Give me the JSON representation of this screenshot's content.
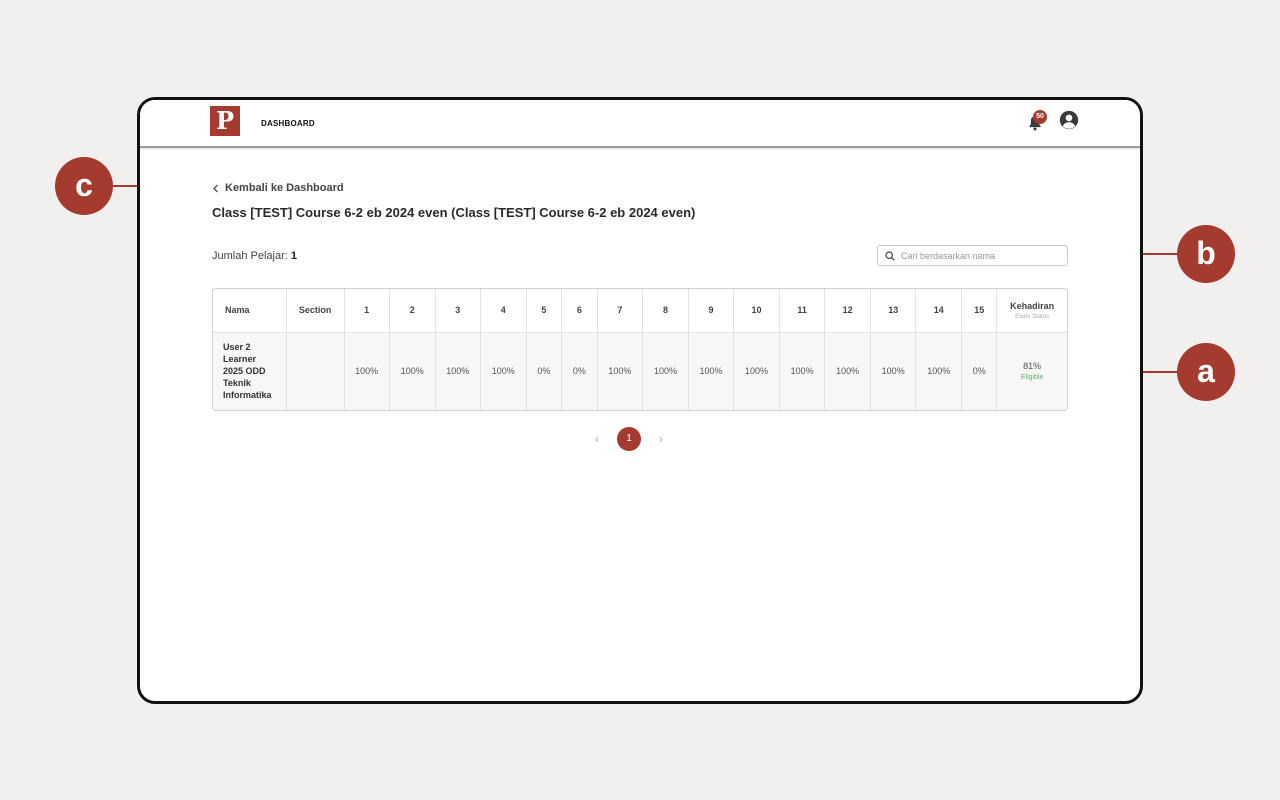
{
  "header": {
    "logo_letter": "P",
    "nav_label": "DASHBOARD",
    "notification_count": "50"
  },
  "back_link": "Kembali ke Dashboard",
  "title": "Class [TEST] Course 6-2 eb 2024 even (Class [TEST] Course 6-2 eb 2024 even)",
  "student_count": {
    "label": "Jumlah Pelajar:",
    "value": "1"
  },
  "search": {
    "placeholder": "Cari berdasarkan nama"
  },
  "table": {
    "name_header": "Nama",
    "section_header": "Section",
    "session_headers": [
      "1",
      "2",
      "3",
      "4",
      "5",
      "6",
      "7",
      "8",
      "9",
      "10",
      "11",
      "12",
      "13",
      "14",
      "15"
    ],
    "attendance_header": "Kehadiran",
    "attendance_subheader": "Exam Status",
    "rows": [
      {
        "name_lines": [
          "User 2",
          "Learner",
          "2025 ODD",
          "Teknik",
          "Informatika"
        ],
        "section": "",
        "sessions": [
          "100%",
          "100%",
          "100%",
          "100%",
          "0%",
          "0%",
          "100%",
          "100%",
          "100%",
          "100%",
          "100%",
          "100%",
          "100%",
          "100%",
          "0%"
        ],
        "attendance": "81%",
        "status": "Eligible"
      }
    ]
  },
  "pagination": {
    "current": "1",
    "prev": "‹",
    "next": "›"
  },
  "callouts": {
    "a": "a",
    "b": "b",
    "c": "c"
  },
  "colors": {
    "accent": "#a53a2f",
    "eligible": "#5bb36b"
  },
  "icons": [
    "notification-bell-icon",
    "user-avatar-icon",
    "chevron-left-icon",
    "search-icon"
  ]
}
